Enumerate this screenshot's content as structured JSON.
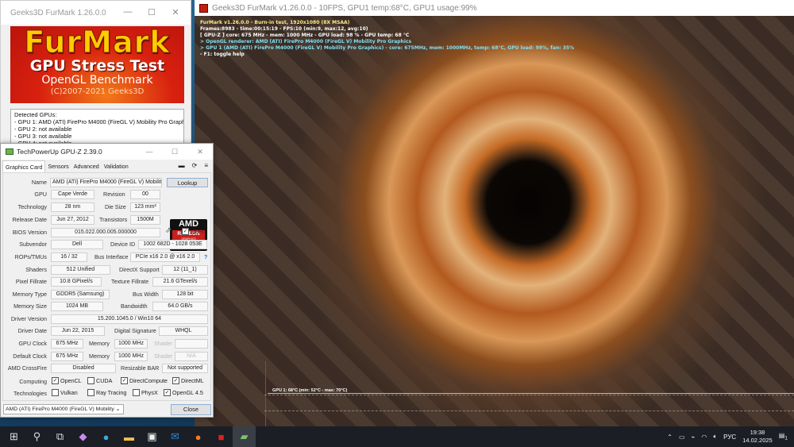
{
  "furmark_launcher": {
    "title": "Geeks3D FurMark 1.26.0.0",
    "logo": {
      "name": "FurMark",
      "line1": "GPU Stress Test",
      "line2": "OpenGL Benchmark",
      "line3": "(C)2007-2021 Geeks3D"
    },
    "detected_gpus": [
      "Detected GPUs:",
      "- GPU 1: AMD (ATI) FirePro M4000 (FireGL V) Mobility Pro Graphics, GP",
      "- GPU 2: not available",
      "- GPU 3: not available",
      "- GPU 4: not available"
    ]
  },
  "render_window": {
    "title": "Geeks3D FurMark v1.26.0.0 - 10FPS, GPU1 temp:68°C, GPU1 usage:99%",
    "osd": [
      "FurMark v1.26.0.0 - Burn-in test, 1920x1080 (8X MSAA)",
      "Frames:8983 - time:00:15:19 - FPS:10 (min:9, max:12, avg:10)",
      "[ GPU-Z ] core: 675 MHz - mem: 1000 MHz - GPU load: 98 % - GPU temp: 68 °C",
      "> OpenGL renderer: AMD (ATI) FirePro M4000 (FireGL V) Mobility Pro Graphics",
      "> GPU 1 (AMD (ATI) FirePro M4000 (FireGL V) Mobility Pro Graphics) - core: 675MHz, mem: 1000MHz, temp: 68°C, GPU load: 99%, fan: 35%",
      "- F1: toggle help"
    ],
    "temp_graph_label": "GPU 1: 68°C (min: 52°C - max: 70°C)"
  },
  "gpuz": {
    "title": "TechPowerUp GPU-Z 2.39.0",
    "tabs": [
      "Graphics Card",
      "Sensors",
      "Advanced",
      "Validation"
    ],
    "labels": {
      "name": "Name",
      "gpu": "GPU",
      "revision": "Revision",
      "technology": "Technology",
      "die_size": "Die Size",
      "release_date": "Release Date",
      "transistors": "Transistors",
      "bios": "BIOS Version",
      "uefi": "UEFI",
      "subvendor": "Subvendor",
      "device_id": "Device ID",
      "rops": "ROPs/TMUs",
      "bus_interface": "Bus Interface",
      "shaders": "Shaders",
      "directx": "DirectX Support",
      "pixel": "Pixel Fillrate",
      "texture": "Texture Fillrate",
      "mem_type": "Memory Type",
      "bus_width": "Bus Width",
      "mem_size": "Memory Size",
      "bandwidth": "Bandwidth",
      "driver_version": "Driver Version",
      "driver_date": "Driver Date",
      "digital_signature": "Digital Signature",
      "gpu_clock": "GPU Clock",
      "memory": "Memory",
      "shader": "Shader",
      "default_clock": "Default Clock",
      "crossfire": "AMD CrossFire",
      "resizable_bar": "Resizable BAR",
      "computing": "Computing",
      "technologies": "Technologies"
    },
    "values": {
      "name": "AMD (ATI) FirePro M4000 (FireGL V) Mobilit...",
      "gpu": "Cape Verde",
      "revision": "00",
      "technology": "28 nm",
      "die_size": "123 mm²",
      "release_date": "Jun 27, 2012",
      "transistors": "1500M",
      "bios": "015.022.000.005.000000",
      "subvendor": "Dell",
      "device_id": "1002 682D - 1028 053E",
      "rops": "16 / 32",
      "bus_interface": "PCIe x16 2.0 @ x16 2.0",
      "shaders": "512 Unified",
      "directx": "12 (11_1)",
      "pixel": "10.8 GPixel/s",
      "texture": "21.6 GTexel/s",
      "mem_type": "GDDR5 (Samsung)",
      "bus_width": "128 bit",
      "mem_size": "1024 MB",
      "bandwidth": "64.0 GB/s",
      "driver_version": "15.200.1045.0 / Win10 64",
      "driver_date": "Jun 22, 2015",
      "digital_signature": "WHQL",
      "gpu_clock": "675 MHz",
      "gpu_mem_clock": "1000 MHz",
      "gpu_shader": "",
      "default_clock": "675 MHz",
      "default_mem_clock": "1000 MHz",
      "default_shader": "N/A",
      "crossfire": "Disabled",
      "resizable_bar": "Not supported"
    },
    "uefi_checked": true,
    "computing": [
      {
        "label": "OpenCL",
        "checked": true
      },
      {
        "label": "CUDA",
        "checked": false
      },
      {
        "label": "DirectCompute",
        "checked": true
      },
      {
        "label": "DirectML",
        "checked": true
      }
    ],
    "technologies": [
      {
        "label": "Vulkan",
        "checked": false
      },
      {
        "label": "Ray Tracing",
        "checked": false
      },
      {
        "label": "PhysX",
        "checked": false
      },
      {
        "label": "OpenGL 4.5",
        "checked": true
      }
    ],
    "lookup": "Lookup",
    "close": "Close",
    "help": "?",
    "selected_gpu": "AMD (ATI) FirePro M4000 (FireGL V) Mobility",
    "logo": {
      "brand": "AMD",
      "sub": "RADEON",
      "sub2": "GRAPHICS"
    }
  },
  "taskbar": {
    "tray": {
      "lang": "РУС",
      "time": "19:38",
      "date": "14.02.2025",
      "notifications": "1"
    }
  }
}
